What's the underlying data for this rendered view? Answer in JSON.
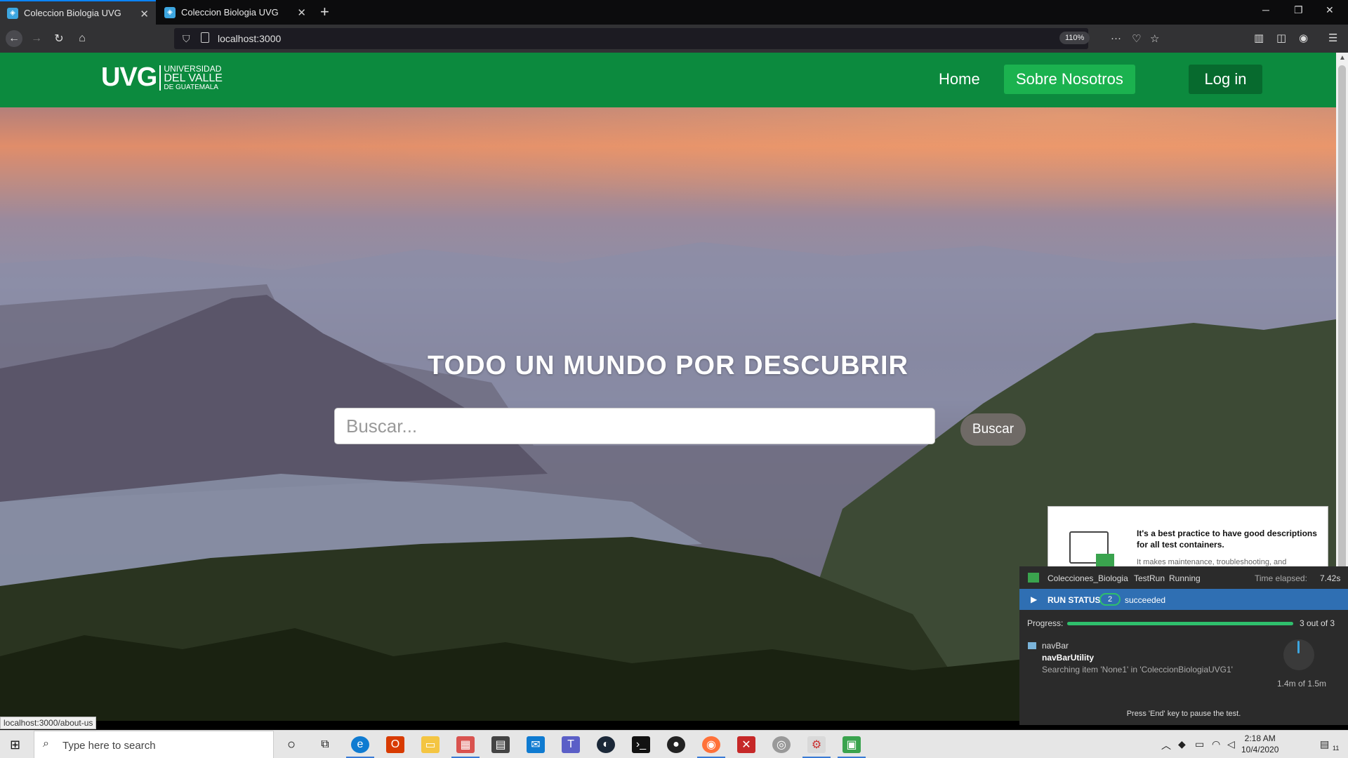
{
  "browser": {
    "tabs": [
      {
        "title": "Coleccion Biologia UVG",
        "active": true
      },
      {
        "title": "Coleccion Biologia UVG",
        "active": false
      }
    ],
    "url": "localhost:3000",
    "zoom": "110%",
    "status_link": "localhost:3000/about-us"
  },
  "site": {
    "logo": {
      "mark": "UVG",
      "line1": "UNIVERSIDAD",
      "line2": "DEL VALLE",
      "line3": "DE GUATEMALA"
    },
    "nav": {
      "home": "Home",
      "about": "Sobre Nosotros",
      "login": "Log in"
    },
    "hero_title": "TODO UN MUNDO POR DESCUBRIR",
    "search": {
      "placeholder": "Buscar...",
      "button": "Buscar"
    }
  },
  "test_panel": {
    "tip_title": "It's a best practice to have good descriptions for all test containers.",
    "tip_body": "It makes maintenance, troubleshooting, and",
    "project": "Colecciones_Biologia",
    "mode": "TestRun",
    "state": "Running",
    "elapsed_label": "Time elapsed:",
    "elapsed": "7.42s",
    "run_status_label": "RUN STATUS",
    "succeeded_count": "2",
    "succeeded_label": "succeeded",
    "progress_label": "Progress:",
    "progress_fraction": 1.0,
    "progress_text": "3 out of 3",
    "item_parent": "navBar",
    "item_name": "navBarUtility",
    "item_detail": "Searching item 'None1' in 'ColeccionBiologiaUVG1'",
    "memory": "1.4m of 1.5m",
    "footer": "Press 'End' key to pause the test."
  },
  "taskbar": {
    "search_placeholder": "Type here to search",
    "time": "2:18 AM",
    "date": "10/4/2020",
    "notifications": "11"
  }
}
